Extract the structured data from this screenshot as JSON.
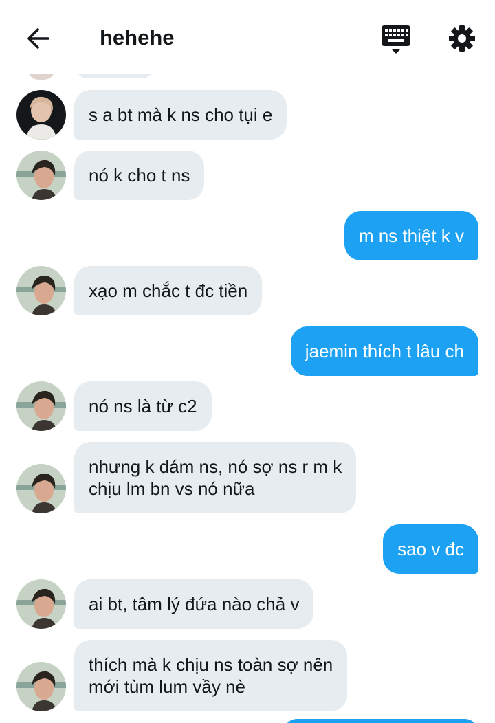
{
  "header": {
    "title": "hehehe",
    "back_icon": "arrow-left-icon",
    "keyboard_icon": "keyboard-icon",
    "settings_icon": "gear-icon"
  },
  "colors": {
    "incoming_bubble": "#e6ecf0",
    "outgoing_bubble": "#1da1f2",
    "text": "#14171a"
  },
  "messages": [
    {
      "direction": "in",
      "text": "s a bt mà k ns cho tụi e",
      "avatar": "avatar-dark-hair"
    },
    {
      "direction": "in",
      "text": "nó k cho t ns",
      "avatar": "avatar-portrait"
    },
    {
      "direction": "out",
      "text": "m ns thiệt k v"
    },
    {
      "direction": "in",
      "text": "xạo m chắc t đc tiền",
      "avatar": "avatar-portrait"
    },
    {
      "direction": "out",
      "text": "jaemin thích t lâu ch"
    },
    {
      "direction": "in",
      "text": "nó ns là từ c2",
      "avatar": "avatar-portrait"
    },
    {
      "direction": "in",
      "text": "nhưng k dám ns, nó sợ ns r m k\nchịu lm bn vs nó nữa",
      "avatar": "avatar-portrait"
    },
    {
      "direction": "out",
      "text": "sao v đc"
    },
    {
      "direction": "in",
      "text": "ai bt, tâm lý đứa nào chả v",
      "avatar": "avatar-portrait"
    },
    {
      "direction": "in",
      "text": "thích mà k chịu ns toàn sợ nên\nmới tùm lum vầy nè",
      "avatar": "avatar-portrait"
    }
  ]
}
